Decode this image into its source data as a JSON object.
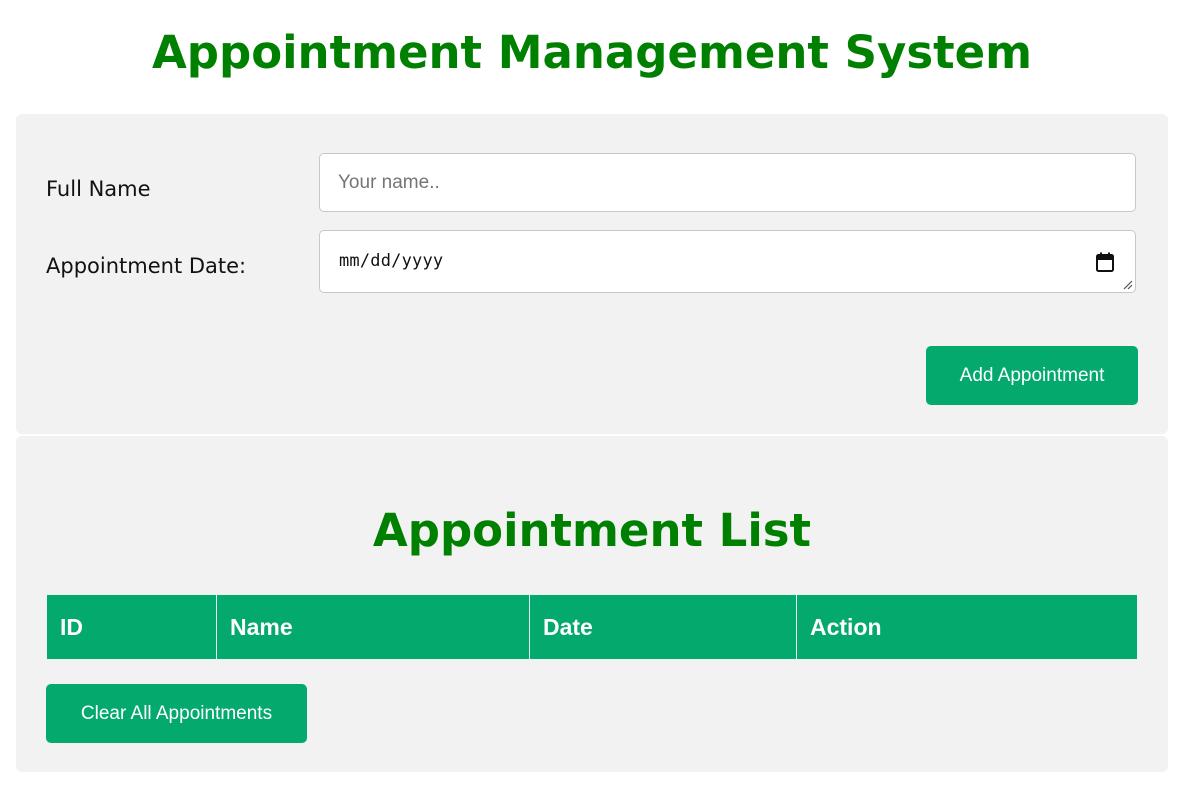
{
  "header": {
    "title": "Appointment Management System"
  },
  "form": {
    "name_label": "Full Name",
    "name_placeholder": "Your name..",
    "name_value": "",
    "date_label": "Appointment Date:",
    "date_placeholder": "mm/dd/yyyy",
    "date_icon": "calendar-icon",
    "submit_label": "Add Appointment"
  },
  "list": {
    "title": "Appointment List",
    "columns": [
      "ID",
      "Name",
      "Date",
      "Action"
    ],
    "rows": [],
    "clear_label": "Clear All Appointments"
  },
  "colors": {
    "title": "#008000",
    "accent": "#04a96d",
    "panel": "#f2f2f2"
  }
}
